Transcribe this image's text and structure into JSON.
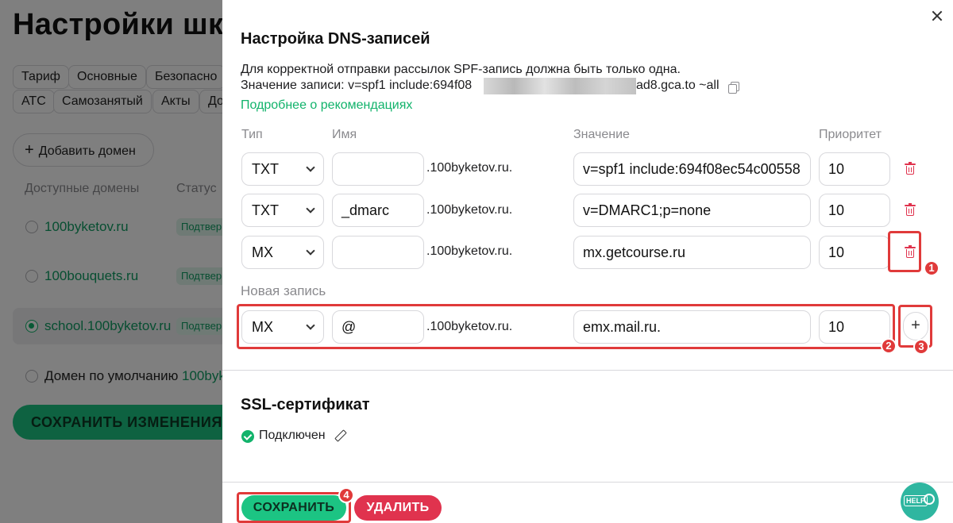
{
  "background": {
    "page_title": "Настройки шко",
    "tabs_row1": [
      "Тариф",
      "Основные",
      "Безопасно"
    ],
    "tabs_row2": [
      "АТС",
      "Самозанятый",
      "Акты",
      "До"
    ],
    "add_domain_label": "Добавить домен",
    "col_domains": "Доступные домены",
    "col_status": "Статус",
    "domains": [
      {
        "name": "100byketov.ru",
        "badge": "Подтвер",
        "selected": false
      },
      {
        "name": "100bouquets.ru",
        "badge": "Подтвер",
        "selected": false
      },
      {
        "name": "school.100byketov.ru",
        "badge": "Подтвер",
        "selected": true
      }
    ],
    "default_domain_label": "Домен по умолчанию",
    "default_domain_value": "100byk",
    "save_changes_label": "СОХРАНИТЬ ИЗМЕНЕНИЯ"
  },
  "modal": {
    "dns_title": "Настройка DNS-записей",
    "note": "Для корректной отправки рассылок SPF-запись должна быть только одна.",
    "value_prefix": "Значение записи: v=spf1 include:694f08",
    "value_suffix": "ad8.gca.to ~all",
    "more_link": "Подробнее о рекомендациях",
    "columns": {
      "type": "Тип",
      "name": "Имя",
      "value": "Значение",
      "priority": "Приоритет"
    },
    "records": [
      {
        "type": "TXT",
        "name": "",
        "domain_suffix": ".100byketov.ru.",
        "value": "v=spf1 include:694f08ec54c00558",
        "priority": "10"
      },
      {
        "type": "TXT",
        "name": "_dmarc",
        "domain_suffix": ".100byketov.ru.",
        "value": "v=DMARC1;p=none",
        "priority": "10"
      },
      {
        "type": "MX",
        "name": "",
        "domain_suffix": ".100byketov.ru.",
        "value": "mx.getcourse.ru",
        "priority": "10"
      }
    ],
    "new_record_label": "Новая запись",
    "new_record": {
      "type": "MX",
      "name": "@",
      "domain_suffix": ".100byketov.ru.",
      "value": "emx.mail.ru.",
      "priority": "10"
    },
    "add_symbol": "+",
    "ssl_title": "SSL-сертификат",
    "ssl_status": "Подключен",
    "save_label": "СОХРАНИТЬ",
    "delete_label": "УДАЛИТЬ"
  },
  "help_label": "HELP",
  "annotations": [
    "1",
    "2",
    "3",
    "4"
  ],
  "colors": {
    "accent_green": "#1cc483",
    "danger_red": "#e0334e",
    "annotation_red": "#e03a3a",
    "help_teal": "#2fb6a0"
  },
  "icons": [
    "close-icon",
    "copy-icon",
    "chevron-down-icon",
    "trash-icon",
    "plus-icon",
    "check-circle-icon",
    "pencil-icon",
    "help-search-icon"
  ]
}
